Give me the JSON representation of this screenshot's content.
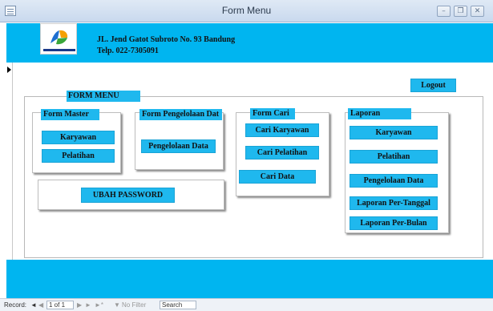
{
  "window": {
    "title": "Form Menu"
  },
  "header": {
    "address": "JL. Jend Gatot Subroto No. 93 Bandung",
    "phone": "Telp. 022-7305091",
    "accent_color": "#00b5f0"
  },
  "toolbar": {
    "logout_label": "Logout"
  },
  "form_menu": {
    "title": "FORM MENU"
  },
  "form_master": {
    "title": "Form Master",
    "buttons": [
      "Karyawan",
      "Pelatihan"
    ]
  },
  "form_pengelolaan": {
    "title": "Form Pengelolaan Dat",
    "buttons": [
      "Pengelolaan Data"
    ]
  },
  "form_cari": {
    "title": "Form Cari",
    "buttons": [
      "Cari Karyawan",
      "Cari Pelatihan",
      "Cari Data"
    ]
  },
  "laporan": {
    "title": "Laporan",
    "buttons": [
      "Karyawan",
      "Pelatihan",
      "Pengelolaan Data",
      "Laporan Per-Tanggal",
      "Laporan Per-Bulan"
    ]
  },
  "password": {
    "label": "UBAH PASSWORD"
  },
  "navigation": {
    "record_label": "Record:",
    "position": "1 of 1",
    "filter_label": "No Filter",
    "search_placeholder": "Search"
  }
}
